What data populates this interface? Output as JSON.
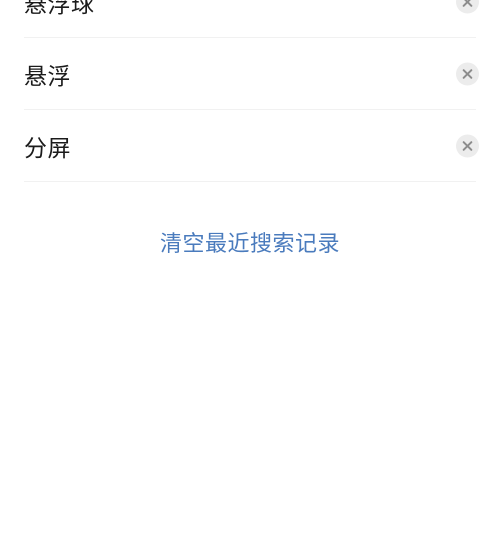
{
  "recent_searches": {
    "items": [
      {
        "label": "悬浮球",
        "delete_icon": "close-icon"
      },
      {
        "label": "悬浮",
        "delete_icon": "close-icon"
      },
      {
        "label": "分屏",
        "delete_icon": "close-icon"
      }
    ],
    "clear_label": "清空最近搜索记录"
  },
  "colors": {
    "link": "#4a7bbd",
    "text": "#1b1b1b",
    "icon_bg": "#ececec",
    "icon_fg": "#8c8c8c",
    "divider": "#f1f1f1"
  }
}
